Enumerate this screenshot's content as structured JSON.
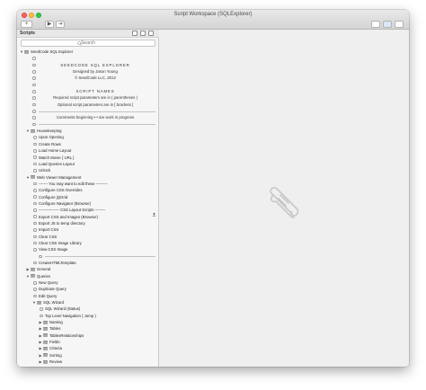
{
  "window": {
    "title": "Script Workspace (SQLExplorer)"
  },
  "toolbar": {
    "add_label": "+",
    "run_label": "▶",
    "debug_label": "⇥"
  },
  "sidebar": {
    "title": "Scripts",
    "search_placeholder": "Search"
  },
  "scripts": [
    {
      "type": "folder",
      "depth": 0,
      "open": true,
      "label": "SeedCode SQL Explorer"
    },
    {
      "type": "comment",
      "depth": 1,
      "label": ""
    },
    {
      "type": "comment",
      "depth": 1,
      "label": "SEEDCODE SQL EXPLORER",
      "heading": true
    },
    {
      "type": "comment",
      "depth": 1,
      "label": "Designed by Jason Young"
    },
    {
      "type": "comment",
      "depth": 1,
      "label": "© SeedCode LLC, 2012"
    },
    {
      "type": "comment",
      "depth": 1,
      "label": ""
    },
    {
      "type": "comment",
      "depth": 1,
      "label": "SCRIPT NAMES",
      "heading": true
    },
    {
      "type": "comment",
      "depth": 1,
      "label": "Required script parameters are in ( parentheses )"
    },
    {
      "type": "comment",
      "depth": 1,
      "label": "Optional script parameters are in [ brackets ]"
    },
    {
      "type": "separator",
      "depth": 1
    },
    {
      "type": "comment",
      "depth": 1,
      "label": "Comments beginning • • are work in progress"
    },
    {
      "type": "separator",
      "depth": 1
    },
    {
      "type": "folder",
      "depth": 1,
      "open": true,
      "label": "Housekeeping"
    },
    {
      "type": "script",
      "depth": 2,
      "label": "Upon Opening"
    },
    {
      "type": "script",
      "depth": 2,
      "label": "Create Rows"
    },
    {
      "type": "script",
      "depth": 2,
      "label": "Load Home Layout"
    },
    {
      "type": "script",
      "depth": 2,
      "label": "Watch Movie { URL }"
    },
    {
      "type": "script",
      "depth": 2,
      "label": "Load Queries Layout"
    },
    {
      "type": "script",
      "depth": 2,
      "label": "Unlock"
    },
    {
      "type": "folder",
      "depth": 1,
      "open": true,
      "label": "Web Viewer Management"
    },
    {
      "type": "script",
      "depth": 2,
      "label": "------- You may want to edit these ---------"
    },
    {
      "type": "script",
      "depth": 2,
      "label": "Configure CSS Overrides"
    },
    {
      "type": "script",
      "depth": 2,
      "label": "Configure jQGrid"
    },
    {
      "type": "script",
      "depth": 2,
      "label": "Configure Navigator (Browser)"
    },
    {
      "type": "script",
      "depth": 2,
      "label": "---------------- CSS Layout Scripts --------"
    },
    {
      "type": "script",
      "depth": 2,
      "label": "Export CSS and Images (Browser)"
    },
    {
      "type": "script",
      "depth": 2,
      "label": "Export JS to temp directory"
    },
    {
      "type": "script",
      "depth": 2,
      "label": "Import CSS"
    },
    {
      "type": "script",
      "depth": 2,
      "label": "Clear CSS"
    },
    {
      "type": "script",
      "depth": 2,
      "label": "Clear CSS Image Library"
    },
    {
      "type": "script",
      "depth": 2,
      "label": "View CSS Image"
    },
    {
      "type": "separator",
      "depth": 2
    },
    {
      "type": "script",
      "depth": 2,
      "label": "CreateHTMLTemplate"
    },
    {
      "type": "folder",
      "depth": 1,
      "open": false,
      "label": "General"
    },
    {
      "type": "folder",
      "depth": 1,
      "open": true,
      "label": "Queries"
    },
    {
      "type": "script",
      "depth": 2,
      "label": "New Query"
    },
    {
      "type": "script",
      "depth": 2,
      "label": "Duplicate Query"
    },
    {
      "type": "script",
      "depth": 2,
      "label": "Edit Query"
    },
    {
      "type": "folder",
      "depth": 2,
      "open": true,
      "label": "SQL Wizard"
    },
    {
      "type": "script",
      "depth": 3,
      "label": "SQL Wizard (Status)"
    },
    {
      "type": "script",
      "depth": 3,
      "label": "Top Level Navigation ( Jump )"
    },
    {
      "type": "folder",
      "depth": 3,
      "open": false,
      "label": "Naming"
    },
    {
      "type": "folder",
      "depth": 3,
      "open": false,
      "label": "Tables"
    },
    {
      "type": "folder",
      "depth": 3,
      "open": false,
      "label": "TablesRelationships"
    },
    {
      "type": "folder",
      "depth": 3,
      "open": false,
      "label": "Fields"
    },
    {
      "type": "folder",
      "depth": 3,
      "open": false,
      "label": "Criteria"
    },
    {
      "type": "folder",
      "depth": 3,
      "open": false,
      "label": "Sorting"
    },
    {
      "type": "folder",
      "depth": 3,
      "open": false,
      "label": "Review"
    },
    {
      "type": "script",
      "depth": 2,
      "label": "RowOnClick"
    }
  ],
  "icons": {
    "search": "search-icon",
    "folder": "folder-icon",
    "script": "script-icon",
    "comment": "comment-icon",
    "upload": "upload-icon",
    "scroll": "script-scroll-icon"
  },
  "colors": {
    "close": "#fc605c",
    "minimize": "#fdbc40",
    "zoom": "#34c84a",
    "folder": "#a9a9a9",
    "placeholder_icon": "#c8c8c8"
  }
}
